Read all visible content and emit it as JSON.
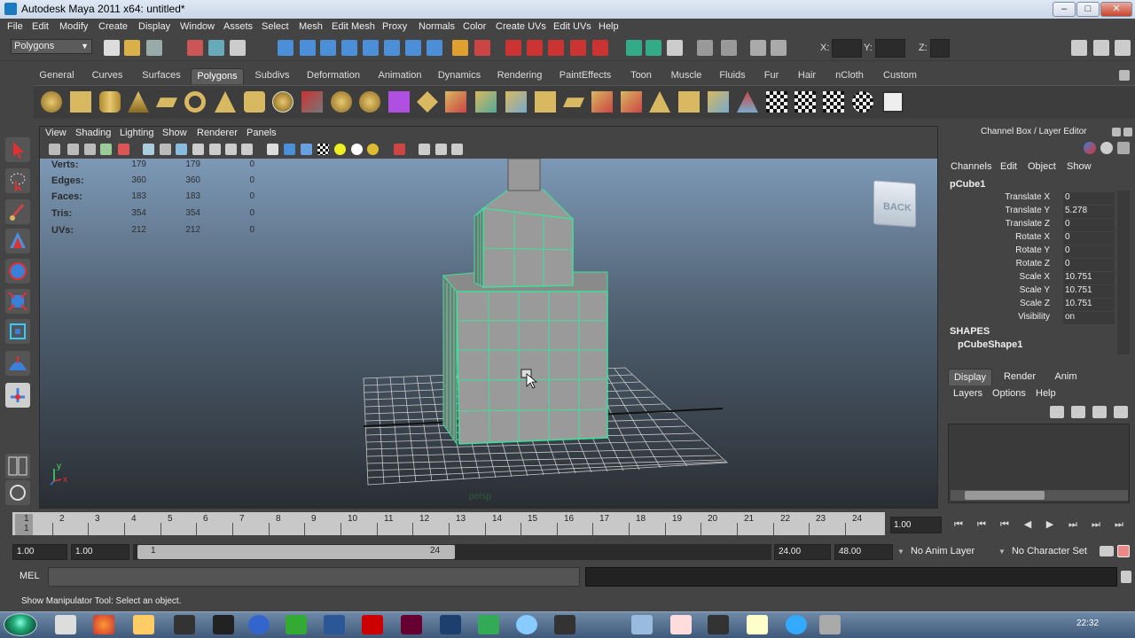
{
  "window": {
    "title": "Autodesk Maya 2011 x64: untitled*"
  },
  "menubar": [
    "File",
    "Edit",
    "Modify",
    "Create",
    "Display",
    "Window",
    "Assets",
    "Select",
    "Mesh",
    "Edit Mesh",
    "Proxy",
    "Normals",
    "Color",
    "Create UVs",
    "Edit UVs",
    "Help"
  ],
  "status_line": {
    "menu_set": "Polygons",
    "x_label": "X:",
    "y_label": "Y:",
    "z_label": "Z:"
  },
  "shelf_tabs": [
    "General",
    "Curves",
    "Surfaces",
    "Polygons",
    "Subdivs",
    "Deformation",
    "Animation",
    "Dynamics",
    "Rendering",
    "PaintEffects",
    "Toon",
    "Muscle",
    "Fluids",
    "Fur",
    "Hair",
    "nCloth",
    "Custom"
  ],
  "active_shelf_tab": "Polygons",
  "panel_menu": [
    "View",
    "Shading",
    "Lighting",
    "Show",
    "Renderer",
    "Panels"
  ],
  "hud": {
    "rows": [
      {
        "label": "Verts:",
        "a": "179",
        "b": "179",
        "c": "0"
      },
      {
        "label": "Edges:",
        "a": "360",
        "b": "360",
        "c": "0"
      },
      {
        "label": "Faces:",
        "a": "183",
        "b": "183",
        "c": "0"
      },
      {
        "label": "Tris:",
        "a": "354",
        "b": "354",
        "c": "0"
      },
      {
        "label": "UVs:",
        "a": "212",
        "b": "212",
        "c": "0"
      }
    ],
    "view_cube": "BACK",
    "camera": "persp",
    "axis_y": "y",
    "axis_x": "x"
  },
  "channel_box": {
    "title": "Channel Box / Layer Editor",
    "menu": [
      "Channels",
      "Edit",
      "Object",
      "Show"
    ],
    "object": "pCube1",
    "attributes": [
      {
        "label": "Translate X",
        "value": "0"
      },
      {
        "label": "Translate Y",
        "value": "5.278"
      },
      {
        "label": "Translate Z",
        "value": "0"
      },
      {
        "label": "Rotate X",
        "value": "0"
      },
      {
        "label": "Rotate Y",
        "value": "0"
      },
      {
        "label": "Rotate Z",
        "value": "0"
      },
      {
        "label": "Scale X",
        "value": "10.751"
      },
      {
        "label": "Scale Y",
        "value": "10.751"
      },
      {
        "label": "Scale Z",
        "value": "10.751"
      },
      {
        "label": "Visibility",
        "value": "on"
      }
    ],
    "shapes_header": "SHAPES",
    "shape": "pCubeShape1"
  },
  "layer_editor": {
    "tabs": [
      "Display",
      "Render",
      "Anim"
    ],
    "active_tab": "Display",
    "menu": [
      "Layers",
      "Options",
      "Help"
    ]
  },
  "time_slider": {
    "ticks": [
      "1",
      "2",
      "3",
      "4",
      "5",
      "6",
      "7",
      "8",
      "9",
      "10",
      "11",
      "12",
      "13",
      "14",
      "15",
      "16",
      "17",
      "18",
      "19",
      "20",
      "21",
      "22",
      "23",
      "24"
    ],
    "current_frame_marker": "1",
    "current_time": "1.00"
  },
  "range_slider": {
    "start": "1.00",
    "playback_start": "1.00",
    "handle_start": "1",
    "handle_end": "24",
    "playback_end": "24.00",
    "end": "48.00",
    "anim_layer": "No Anim Layer",
    "character_set": "No Character Set"
  },
  "command_line": {
    "label": "MEL"
  },
  "help_line": {
    "text": "Show Manipulator Tool: Select an object."
  },
  "taskbar": {
    "clock": "22:32"
  }
}
